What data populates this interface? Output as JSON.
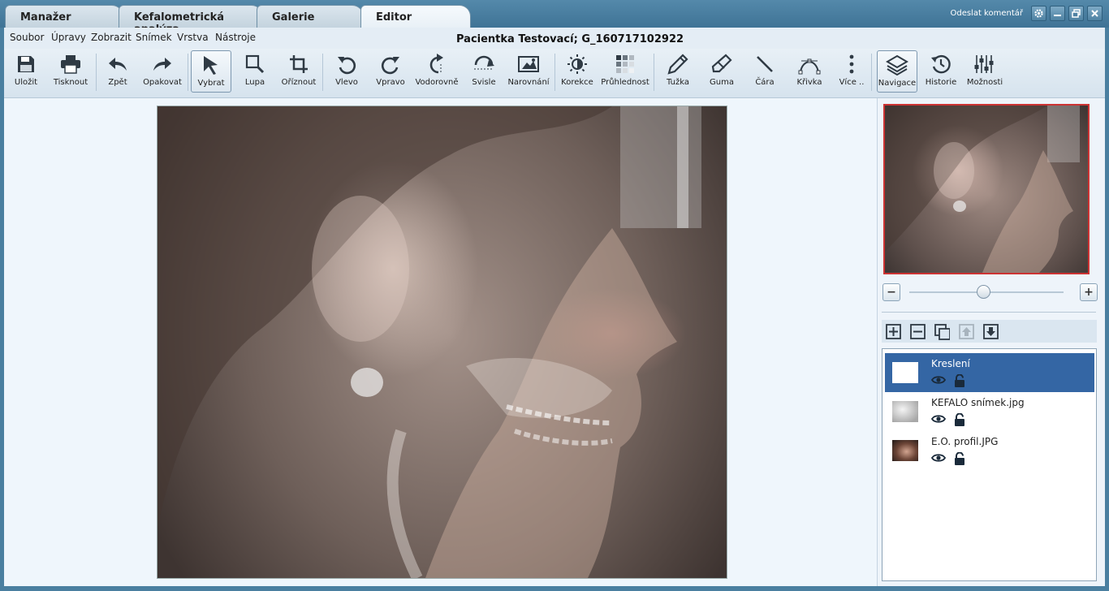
{
  "tabs": [
    {
      "label": "Manažer",
      "active": false
    },
    {
      "label": "Kefalometrická analýza",
      "active": false
    },
    {
      "label": "Galerie",
      "active": false
    },
    {
      "label": "Editor",
      "active": true
    }
  ],
  "window": {
    "feedback_label": "Odeslat komentář",
    "settings_icon": "gear-icon",
    "minimize_icon": "minimize-icon",
    "restore_icon": "restore-icon",
    "close_icon": "close-icon"
  },
  "menu": [
    "Soubor",
    "Úpravy",
    "Zobrazit",
    "Snímek",
    "Vrstva",
    "Nástroje"
  ],
  "document_title": "Pacientka Testovací; G_160717102922",
  "toolbar": [
    {
      "label": "Uložit",
      "icon": "floppy-disk-icon"
    },
    {
      "label": "Tisknout",
      "icon": "printer-icon"
    },
    {
      "label": "Zpět",
      "icon": "undo-icon"
    },
    {
      "label": "Opakovat",
      "icon": "redo-icon"
    },
    {
      "label": "Vybrat",
      "icon": "arrow-pointer-icon",
      "selected": true
    },
    {
      "label": "Lupa",
      "icon": "magnifier-icon"
    },
    {
      "label": "Oříznout",
      "icon": "crop-icon"
    },
    {
      "label": "Vlevo",
      "icon": "rotate-left-icon"
    },
    {
      "label": "Vpravo",
      "icon": "rotate-right-icon"
    },
    {
      "label": "Vodorovně",
      "icon": "flip-horizontal-icon"
    },
    {
      "label": "Svisle",
      "icon": "flip-vertical-icon"
    },
    {
      "label": "Narovnání",
      "icon": "straighten-icon"
    },
    {
      "label": "Korekce",
      "icon": "brightness-icon"
    },
    {
      "label": "Průhlednost",
      "icon": "transparency-icon"
    },
    {
      "label": "Tužka",
      "icon": "pencil-icon"
    },
    {
      "label": "Guma",
      "icon": "eraser-icon"
    },
    {
      "label": "Čára",
      "icon": "line-icon"
    },
    {
      "label": "Křivka",
      "icon": "curve-icon"
    },
    {
      "label": "Více ..",
      "icon": "more-vertical-icon"
    },
    {
      "label": "Navigace",
      "icon": "layers-icon",
      "selected": true
    },
    {
      "label": "Historie",
      "icon": "history-icon"
    },
    {
      "label": "Možnosti",
      "icon": "sliders-icon"
    }
  ],
  "zoom": {
    "minus": "−",
    "plus": "+",
    "level_fraction": 0.48
  },
  "layers": [
    {
      "name": "Kreslení",
      "selected": true,
      "visible": true,
      "locked": false
    },
    {
      "name": "KEFALO snímek.jpg",
      "selected": false,
      "visible": true,
      "locked": false
    },
    {
      "name": "E.O. profil.JPG",
      "selected": false,
      "visible": true,
      "locked": false
    }
  ],
  "colors": {
    "accent": "#3466a4",
    "frame": "#4a7fa0",
    "nav_border": "#cc3333"
  }
}
